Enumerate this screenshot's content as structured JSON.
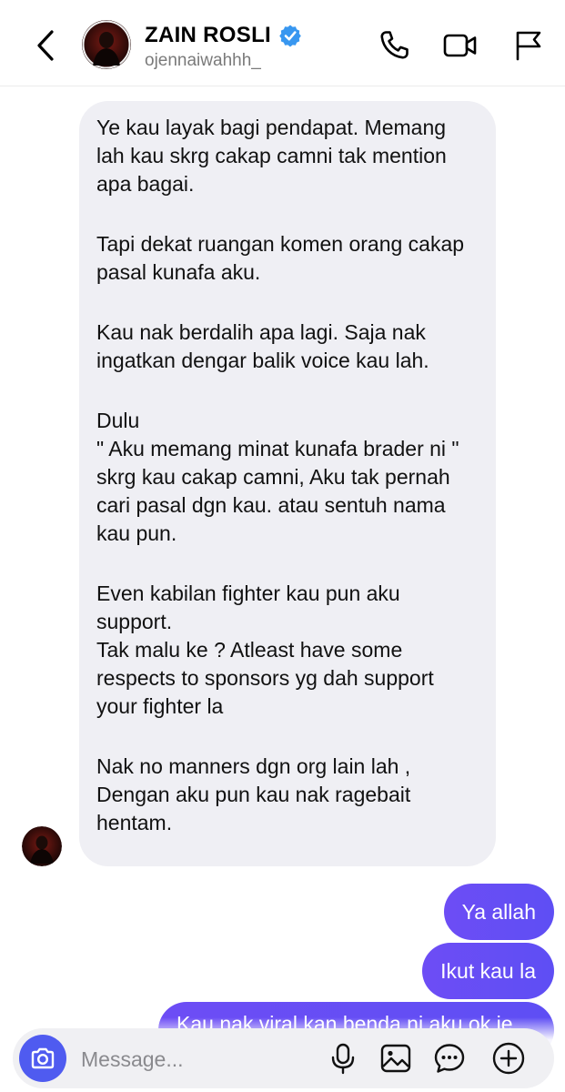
{
  "header": {
    "contact_name": "ZAIN ROSLI",
    "username": "ojennaiwahhh_",
    "icons": [
      "back-icon",
      "verified-badge-icon",
      "phone-icon",
      "video-camera-icon",
      "flag-icon"
    ]
  },
  "messages": {
    "received": {
      "paragraphs": [
        "Ye kau layak bagi pendapat. Memang lah kau skrg cakap camni tak mention apa bagai.",
        "Tapi dekat ruangan komen orang cakap pasal kunafa aku.",
        "Kau nak berdalih apa lagi. Saja nak ingatkan dengar balik voice kau lah.",
        "Dulu\n\" Aku memang minat kunafa brader ni \"  skrg kau cakap camni, Aku tak pernah cari pasal dgn kau. atau sentuh nama kau pun.",
        "Even kabilan fighter kau pun aku support.\nTak malu ke ? Atleast have some respects to sponsors yg dah support your fighter la",
        "Nak no manners dgn org lain lah ,\nDengan aku pun kau nak ragebait hentam."
      ]
    },
    "sent": [
      "Ya allah",
      "Ikut kau la",
      "Kau nak viral kan benda ni aku ok je"
    ]
  },
  "composer": {
    "placeholder": "Message...",
    "icons": [
      "camera-icon",
      "microphone-icon",
      "gallery-icon",
      "sticker-icon",
      "plus-icon"
    ]
  },
  "colors": {
    "accent": "#5e4ef4",
    "camera_button": "#4f5bf0",
    "received_bubble": "#efeff4",
    "verified": "#3897f0"
  }
}
